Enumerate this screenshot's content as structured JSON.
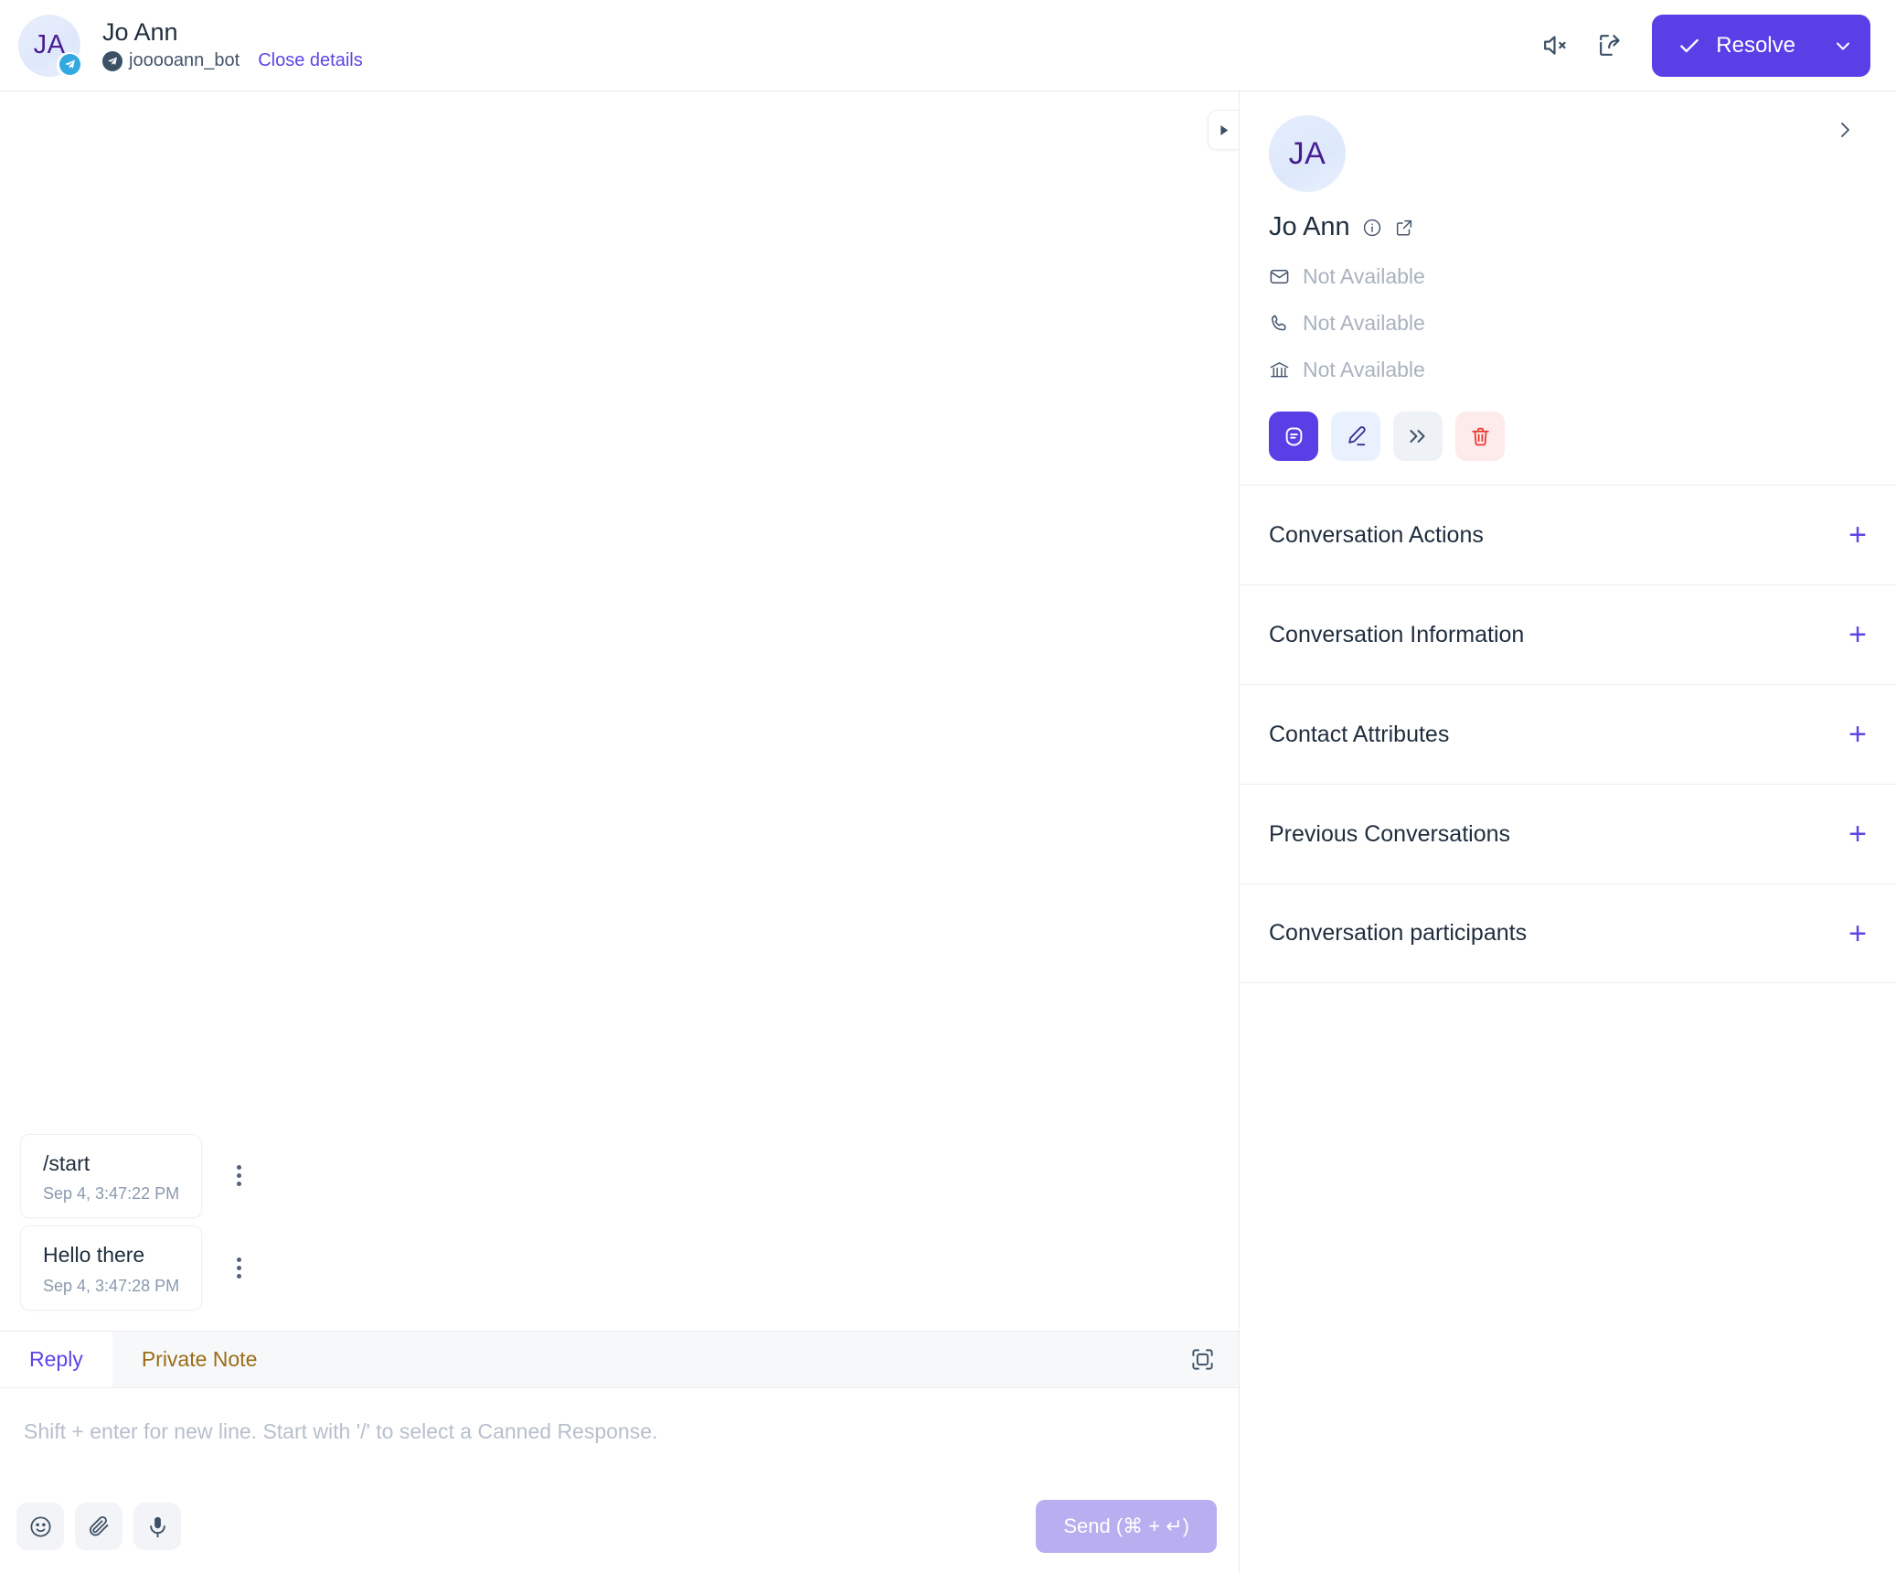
{
  "header": {
    "avatar_initials": "JA",
    "contact_name": "Jo Ann",
    "channel_badge": "telegram-icon",
    "handle": "jooooann_bot",
    "close_details_label": "Close details",
    "mute_icon": "speaker-mute-icon",
    "share_icon": "share-icon",
    "resolve_label": "Resolve",
    "resolve_color": "#5a3fe6"
  },
  "conversation": {
    "panel_toggle_icon": "play-triangle-icon",
    "messages": [
      {
        "text": "/start",
        "time": "Sep 4, 3:47:22 PM",
        "menu_icon": "more-vertical-icon"
      },
      {
        "text": "Hello there",
        "time": "Sep 4, 3:47:28 PM",
        "menu_icon": "more-vertical-icon"
      }
    ]
  },
  "composer": {
    "tabs": [
      {
        "label": "Reply",
        "active": true,
        "color": "#5b46e6"
      },
      {
        "label": "Private Note",
        "active": false,
        "color": "#9a6c15"
      }
    ],
    "expand_icon": "expand-icon",
    "placeholder": "Shift + enter for new line. Start with '/' to select a Canned Response.",
    "tools": [
      {
        "icon": "emoji-icon"
      },
      {
        "icon": "attachment-icon"
      },
      {
        "icon": "microphone-icon"
      }
    ],
    "send_label": "Send (⌘ + ↵)"
  },
  "sidebar": {
    "collapse_icon": "chevron-right-icon",
    "avatar_initials": "JA",
    "contact_name": "Jo Ann",
    "info_icon": "info-circle-icon",
    "external_link_icon": "external-link-icon",
    "details": [
      {
        "icon": "email-icon",
        "value": "Not Available"
      },
      {
        "icon": "phone-icon",
        "value": "Not Available"
      },
      {
        "icon": "company-icon",
        "value": "Not Available"
      }
    ],
    "actions": [
      {
        "icon": "contact-bot-icon",
        "style": "primary"
      },
      {
        "icon": "edit-pencil-icon",
        "style": "blue"
      },
      {
        "icon": "merge-chevrons-icon",
        "style": "gray"
      },
      {
        "icon": "trash-icon",
        "style": "red"
      }
    ],
    "accordion": [
      {
        "label": "Conversation Actions",
        "toggle": "+"
      },
      {
        "label": "Conversation Information",
        "toggle": "+"
      },
      {
        "label": "Contact Attributes",
        "toggle": "+"
      },
      {
        "label": "Previous Conversations",
        "toggle": "+"
      },
      {
        "label": "Conversation participants",
        "toggle": "+"
      }
    ]
  }
}
